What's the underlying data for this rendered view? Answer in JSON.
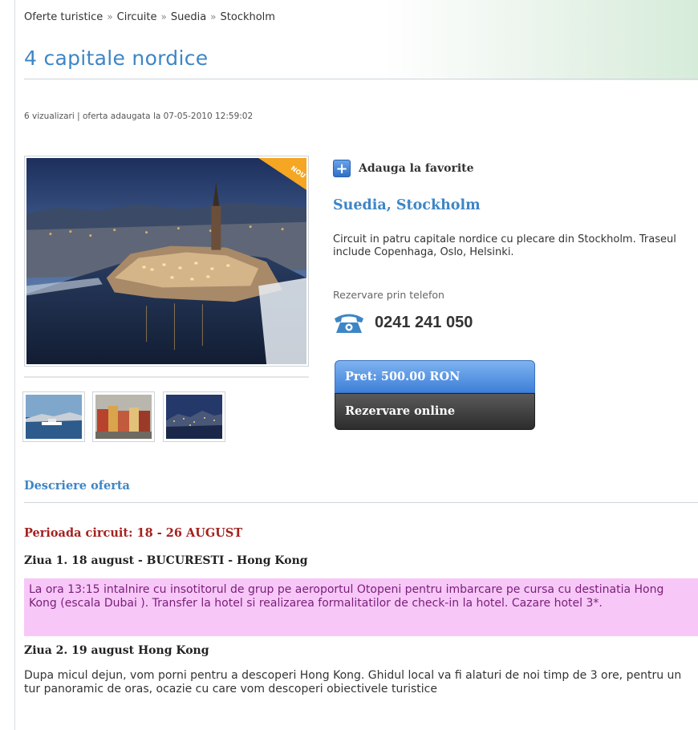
{
  "breadcrumb": [
    "Oferte turistice",
    "Circuite",
    "Suedia",
    "Stockholm"
  ],
  "breadcrumb_separator": "»",
  "title": "4 capitale nordice",
  "meta": "6 vizualizari | oferta adaugata la 07-05-2010 12:59:02",
  "badge": "NOU",
  "favorite_label": "Adauga la favorite",
  "destination": "Suedia, Stockholm",
  "short_description": "Circuit in patru capitale nordice cu plecare din Stockholm. Traseul include Copenhaga, Oslo, Helsinki.",
  "phone_label": "Rezervare prin telefon",
  "phone_number": "0241 241 050",
  "price_label": "Pret: 500.00 RON",
  "booking_label": "Rezervare online",
  "section_title": "Descriere oferta",
  "period": "Perioada circuit: 18 - 26 AUGUST",
  "days": [
    {
      "title": "Ziua 1. 18 august - BUCURESTI - Hong Kong",
      "text": "La ora 13:15 intalnire cu insotitorul de grup pe aeroportul Otopeni pentru imbarcare pe cursa cu destinatia Hong Kong (escala Dubai ). Transfer la hotel si realizarea formalitatilor de check-in la hotel. Cazare hotel 3*."
    },
    {
      "title": "Ziua 2. 19 august Hong Kong",
      "text": "Dupa micul dejun, vom porni pentru a descoperi Hong Kong. Ghidul local va fi alaturi de noi timp de 3 ore, pentru un tur panoramic de oras, ocazie cu care vom descoperi obiectivele turistice"
    }
  ],
  "colors": {
    "accent": "#3d86c6",
    "period": "#a3221f",
    "highlight_bg": "#f7c8f7",
    "highlight_text": "#7a1d7a",
    "badge": "#f5a623"
  },
  "icons": [
    "plus-icon",
    "telephone-icon"
  ]
}
